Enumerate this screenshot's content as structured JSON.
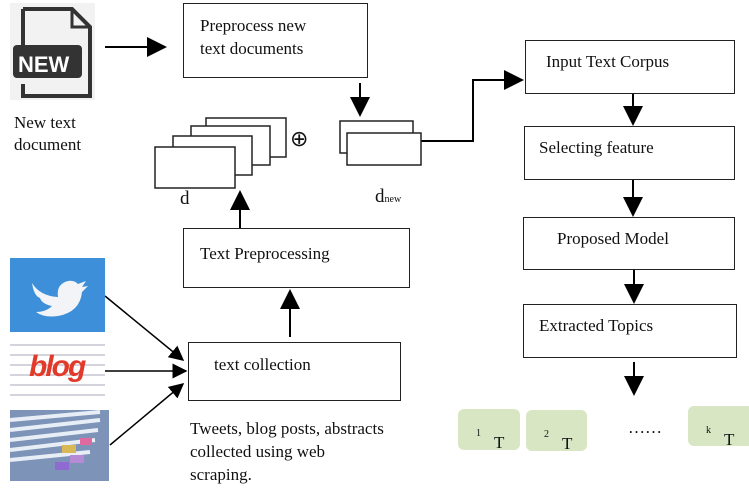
{
  "new_doc": {
    "icon_text": "NEW",
    "label_line1": "New text",
    "label_line2": "document"
  },
  "boxes": {
    "preprocess_new_1": "Preprocess new",
    "preprocess_new_2": "text documents",
    "text_preprocessing": "Text Preprocessing",
    "text_collection": "text collection",
    "input_corpus": "Input Text Corpus",
    "selecting_feature": "Selecting feature",
    "proposed_model": "Proposed Model",
    "extracted_topics": "Extracted Topics"
  },
  "labels": {
    "d": "d",
    "dnew_base": "d",
    "dnew_sub": "new",
    "oplus": "⊕",
    "dots": "……"
  },
  "caption": [
    "Tweets, blog posts, abstracts",
    "collected using web",
    "scraping."
  ],
  "sources": {
    "twitter": "twitter-logo",
    "blog": "blog",
    "blog_text": "blog",
    "papers": "paper-stack"
  },
  "topics": [
    {
      "base": "T",
      "sub": "1"
    },
    {
      "base": "T",
      "sub": "2"
    },
    {
      "base": "T",
      "sub": "k"
    }
  ],
  "colors": {
    "topic_fill": "#d8e6c4",
    "twitter_blue": "#3d8fd9"
  }
}
